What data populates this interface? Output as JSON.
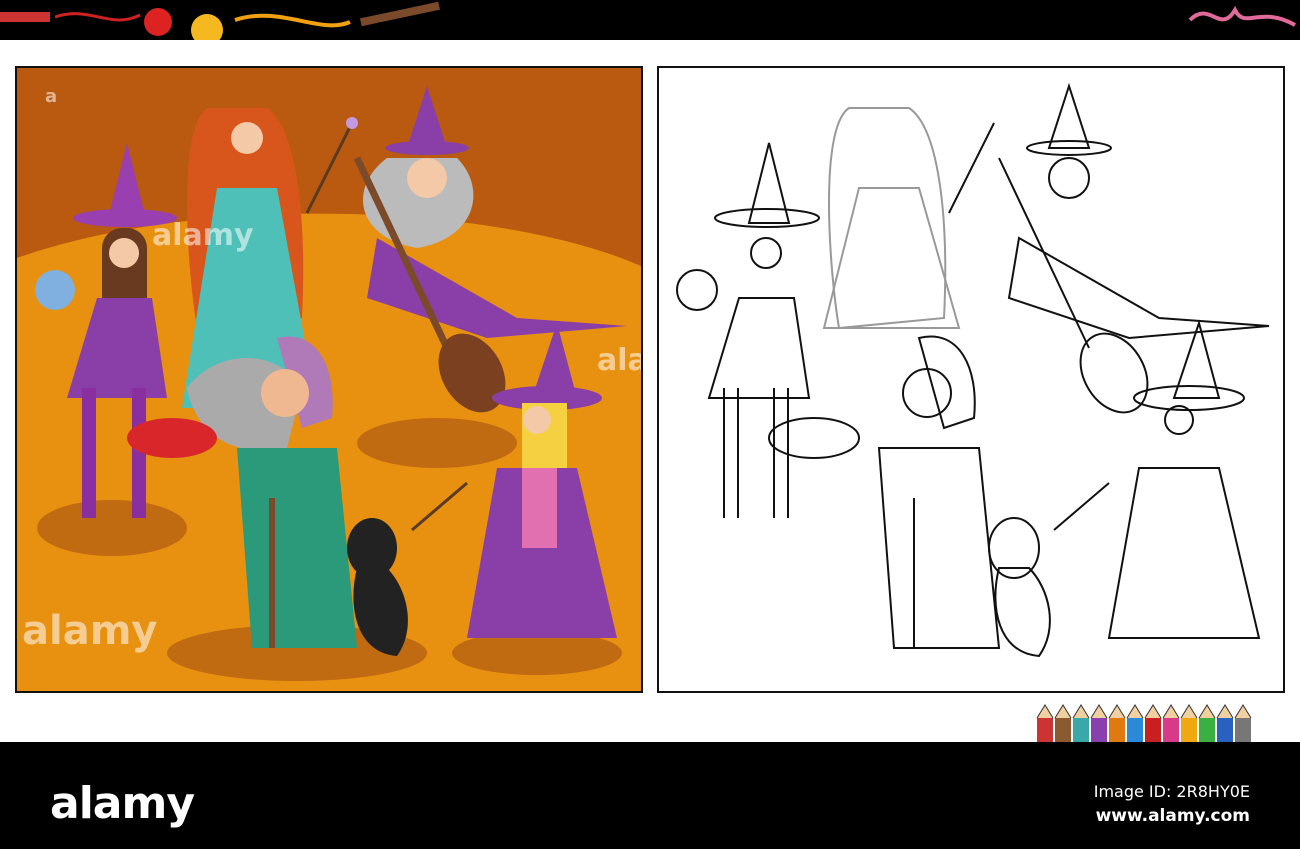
{
  "watermark": "alamy",
  "footer": {
    "logo": "alamy",
    "image_id": "Image ID: 2R8HY0E",
    "website": "www.alamy.com"
  },
  "colors": {
    "background_orange": "#e8900f",
    "floor_dark": "#c0620f",
    "purple": "#8a3fa8",
    "teal": "#4fc0b8"
  }
}
